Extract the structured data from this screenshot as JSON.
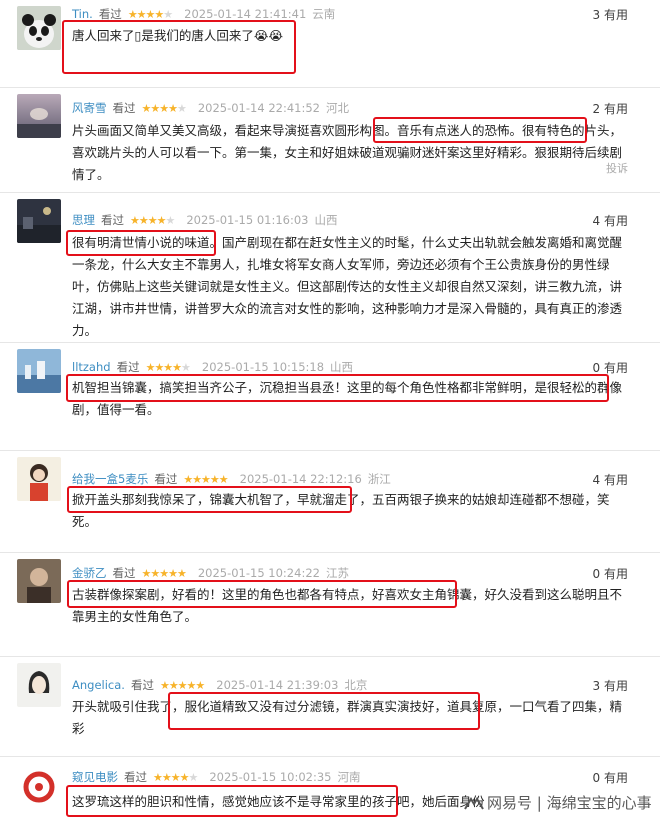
{
  "reviews": [
    {
      "user": "Tin.",
      "status": "看过",
      "stars": 4,
      "date": "2025-01-14 21:41:41",
      "location": "云南",
      "useful": "3 有用",
      "text": "唐人回来了▯是我们的唐人回来了😭😭"
    },
    {
      "user": "风寄雪",
      "status": "看过",
      "stars": 4,
      "date": "2025-01-14 22:41:52",
      "location": "河北",
      "useful": "2 有用",
      "text": "片头画面又简单又美又高级，看起来导演挺喜欢圆形构图。音乐有点迷人的恐怖。很有特色的片头，喜欢跳片头的人可以看一下。第一集，女主和好姐妹破道观骗财迷奸案这里好精彩。狠狠期待后续剧情了。",
      "report": "投诉"
    },
    {
      "user": "思理",
      "status": "看过",
      "stars": 4,
      "date": "2025-01-15 01:16:03",
      "location": "山西",
      "useful": "4 有用",
      "text": "很有明清世情小说的味道。国产剧现在都在赶女性主义的时髦，什么丈夫出轨就会触发离婚和离觉醒一条龙，什么大女主不靠男人，扎堆女将军女商人女军师，旁边还必须有个王公贵族身份的男性绿叶，仿佛贴上这些关键词就是女性主义。但这部剧传达的女性主义却很自然又深刻，讲三教九流，讲江湖，讲市井世情，讲普罗大众的流言对女性的影响，这种影响力才是深入骨髓的，具有真正的渗透力。"
    },
    {
      "user": "lltzahd",
      "status": "看过",
      "stars": 4,
      "date": "2025-01-15 10:15:18",
      "location": "山西",
      "useful": "0 有用",
      "text": "机智担当锦囊，搞笑担当齐公子，沉稳担当县丞！这里的每个角色性格都非常鲜明，是很轻松的群像剧，值得一看。"
    },
    {
      "user": "给我一盒5麦乐",
      "status": "看过",
      "stars": 5,
      "date": "2025-01-14 22:12:16",
      "location": "浙江",
      "useful": "4 有用",
      "text": "掀开盖头那刻我惊呆了，锦囊大机智了，早就溜走了，五百两银子换来的姑娘却连碰都不想碰，笑死。"
    },
    {
      "user": "金骄乙",
      "status": "看过",
      "stars": 5,
      "date": "2025-01-15 10:24:22",
      "location": "江苏",
      "useful": "0 有用",
      "text": "古装群像探案剧，好看的！这里的角色也都各有特点，好喜欢女主角锦囊，好久没看到这么聪明且不靠男主的女性角色了。"
    },
    {
      "user": "Angelica.",
      "status": "看过",
      "stars": 5,
      "date": "2025-01-14 21:39:03",
      "location": "北京",
      "useful": "3 有用",
      "text": "开头就吸引住我了，服化道精致又没有过分滤镜，群演真实演技好，道具复原，一口气看了四集，精彩"
    },
    {
      "user": "窥见电影",
      "status": "看过",
      "stars": 4,
      "date": "2025-01-15 10:02:35",
      "location": "河南",
      "useful": "0 有用",
      "text": "这罗琉这样的胆识和性情，感觉她应该不是寻常家里的孩子吧，她后面身份"
    }
  ],
  "watermark": "网易号 | 海绵宝宝的心事",
  "colors": {
    "link": "#3e8ec2",
    "star": "#f7b32a",
    "highlight": "#e3101a"
  }
}
